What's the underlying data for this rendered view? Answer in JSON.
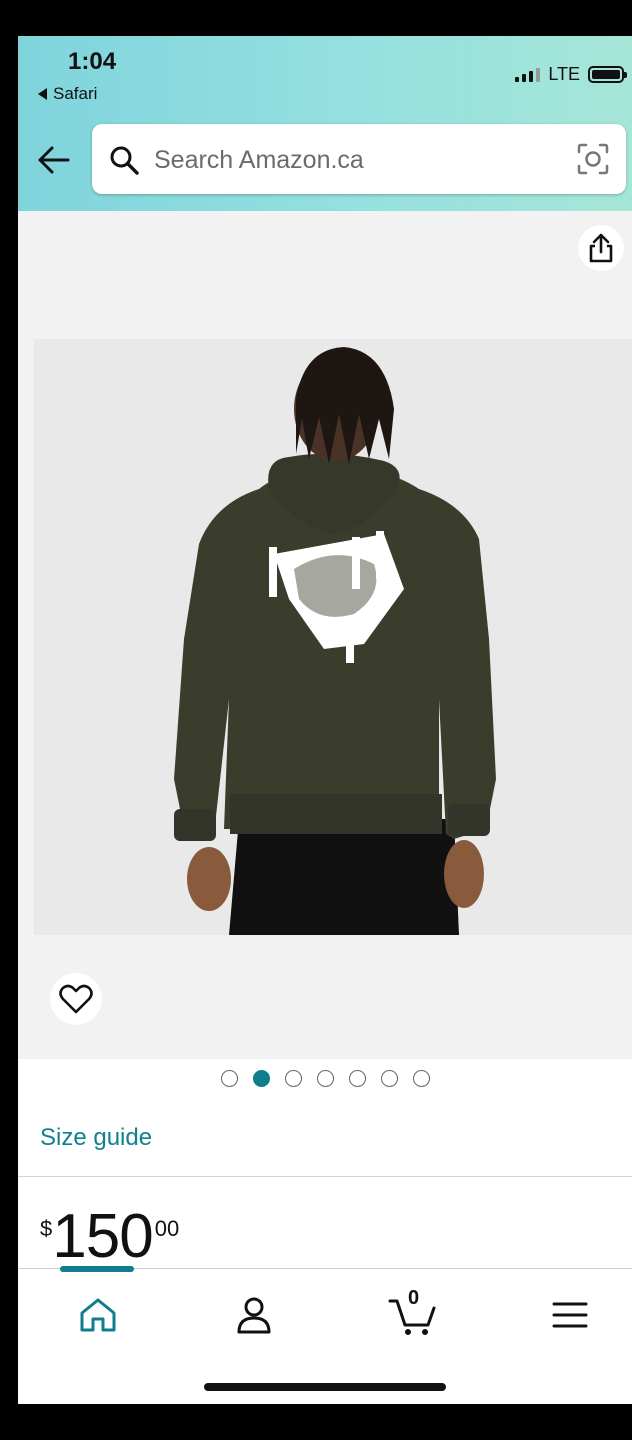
{
  "status_bar": {
    "time": "1:04",
    "back_app_label": "Safari",
    "network": "LTE"
  },
  "search": {
    "placeholder": "Search Amazon.ca"
  },
  "product": {
    "image_alt": "Man wearing a dark olive green hoodie, back view, with white graphic print",
    "carousel": {
      "total": 7,
      "active_index": 1
    },
    "size_guide_label": "Size guide",
    "price": {
      "currency_symbol": "$",
      "whole": "150",
      "fraction": "00"
    }
  },
  "bottom_nav": {
    "items": [
      "home-icon",
      "account-icon",
      "cart-icon",
      "menu-icon"
    ],
    "cart_count": "0",
    "active_item": "home"
  },
  "colors": {
    "accent": "#0f7d8c",
    "hoodie": "#3a3d2c",
    "header_gradient_start": "#7fd4dc",
    "header_gradient_end": "#a6e6d7"
  }
}
